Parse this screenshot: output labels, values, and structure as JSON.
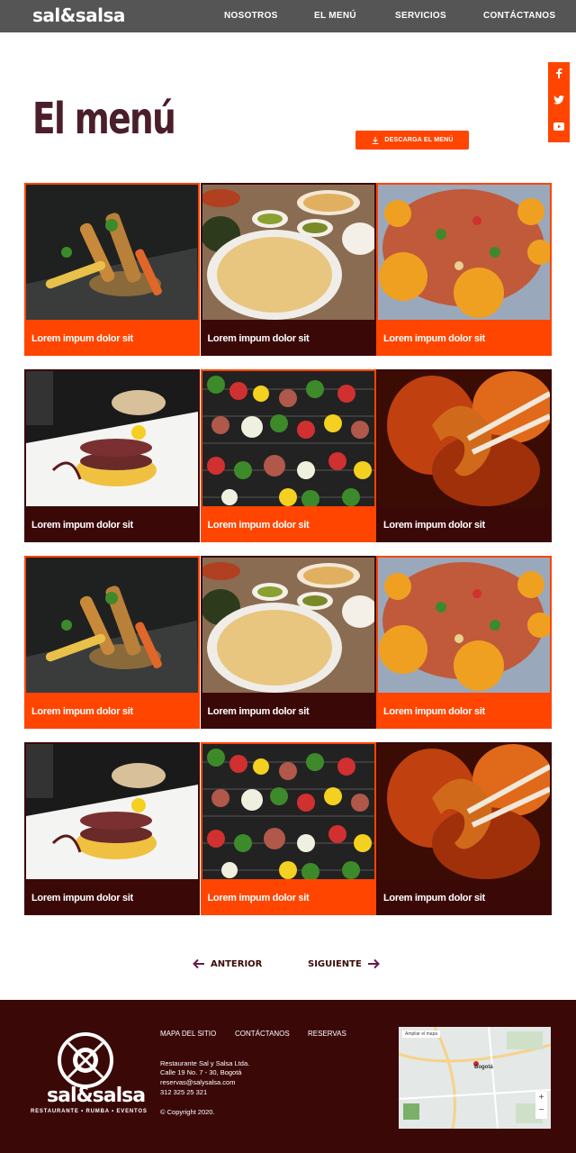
{
  "header": {
    "logo": "sal&salsa",
    "nav": [
      "NOSOTROS",
      "EL MENÚ",
      "SERVICIOS",
      "CONTÁCTANOS"
    ]
  },
  "social": [
    "f",
    "t",
    "yt"
  ],
  "title": "El menú",
  "download_label": "DESCARGA EL MENÚ",
  "cards": [
    [
      {
        "caption": "Lorem impum dolor sit"
      },
      {
        "caption": "Lorem impum dolor sit"
      },
      {
        "caption": "Lorem impum dolor sit"
      }
    ],
    [
      {
        "caption": "Lorem impum dolor sit"
      },
      {
        "caption": "Lorem impum dolor sit"
      },
      {
        "caption": "Lorem impum dolor sit"
      }
    ],
    [
      {
        "caption": "Lorem impum dolor sit"
      },
      {
        "caption": "Lorem impum dolor sit"
      },
      {
        "caption": "Lorem impum dolor sit"
      }
    ],
    [
      {
        "caption": "Lorem impum dolor sit"
      },
      {
        "caption": "Lorem impum dolor sit"
      },
      {
        "caption": "Lorem impum dolor sit"
      }
    ]
  ],
  "pager": {
    "prev": "ANTERIOR",
    "next": "SIGUIENTE"
  },
  "footer": {
    "logo_name": "sal&salsa",
    "logo_tag": "RESTAURANTE • RUMBA • EVENTOS",
    "links": [
      "MAPA DEL SITIO",
      "CONTÁCTANOS",
      "RESERVAS"
    ],
    "company": "Restaurante Sal y Salsa Ltda.",
    "address": "Calle 19 No. 7 - 30, Bogotá",
    "email": "reservas@salysalsa.com",
    "phone": "312 325 25 321",
    "copyright": "© Copyright 2020.",
    "map_city": "Bogotá",
    "map_badge": "Ampliar el mapa"
  },
  "colors": {
    "accent": "#ff4500",
    "dark": "#3b0808",
    "title": "#4a1e2a",
    "topbar": "#555555"
  }
}
